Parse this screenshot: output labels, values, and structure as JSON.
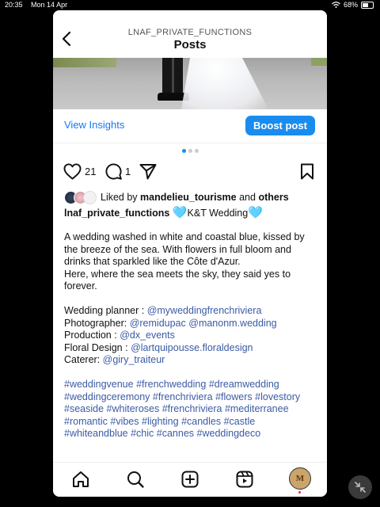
{
  "status": {
    "time": "20:35",
    "date": "Mon 14 Apr",
    "battery": "68%",
    "battery_level": 0.68
  },
  "header": {
    "subtitle": "LNAF_PRIVATE_FUNCTIONS",
    "title": "Posts"
  },
  "insights": {
    "view_label": "View Insights",
    "boost_label": "Boost post"
  },
  "carousel": {
    "count": 3,
    "active_index": 1
  },
  "actions": {
    "like_count": "21",
    "comment_count": "1"
  },
  "liked_by": {
    "prefix": "Liked by",
    "user": "mandelieu_tourisme",
    "and": "and",
    "others": "others"
  },
  "caption": {
    "username": "lnaf_private_functions",
    "emoji": "🩵",
    "title": "K&T Wedding",
    "text1": "A wedding washed in white and coastal blue, kissed by the breeze of the sea. With flowers in full bloom and drinks that sparkled like the Côte d'Azur.",
    "text2": "Here, where the sea meets the sky, they said yes to forever.",
    "credits": [
      {
        "label": "Wedding planner : ",
        "handles": [
          "@myweddingfrenchriviera"
        ]
      },
      {
        "label": "Photographer: ",
        "handles": [
          "@remidupac",
          "@manonm.wedding"
        ]
      },
      {
        "label": "Production : ",
        "handles": [
          "@dx_events"
        ]
      },
      {
        "label": "Floral Design : ",
        "handles": [
          "@lartquipousse.floraldesign"
        ]
      },
      {
        "label": "Caterer: ",
        "handles": [
          "@giry_traiteur"
        ]
      }
    ],
    "hashtags": [
      "#weddingvenue",
      "#frenchwedding",
      "#dreamwedding",
      "#weddingceremony",
      "#frenchriviera",
      "#flowers",
      "#lovestory",
      "#seaside",
      "#whiteroses",
      "#frenchriviera",
      "#mediterranee",
      "#romantic",
      "#vibes",
      "#lighting",
      "#candles",
      "#castle",
      "#whiteandblue",
      "#chic",
      "#cannes",
      "#weddingdeco"
    ]
  },
  "tabbar": {
    "items": [
      "home-icon",
      "search-icon",
      "create-icon",
      "reels-icon",
      "profile-avatar"
    ],
    "profile_initial": "M"
  },
  "colors": {
    "link": "#1877f2",
    "boost": "#1a8cf0",
    "mention": "#3b5ba5",
    "heart": "#55bde6"
  }
}
